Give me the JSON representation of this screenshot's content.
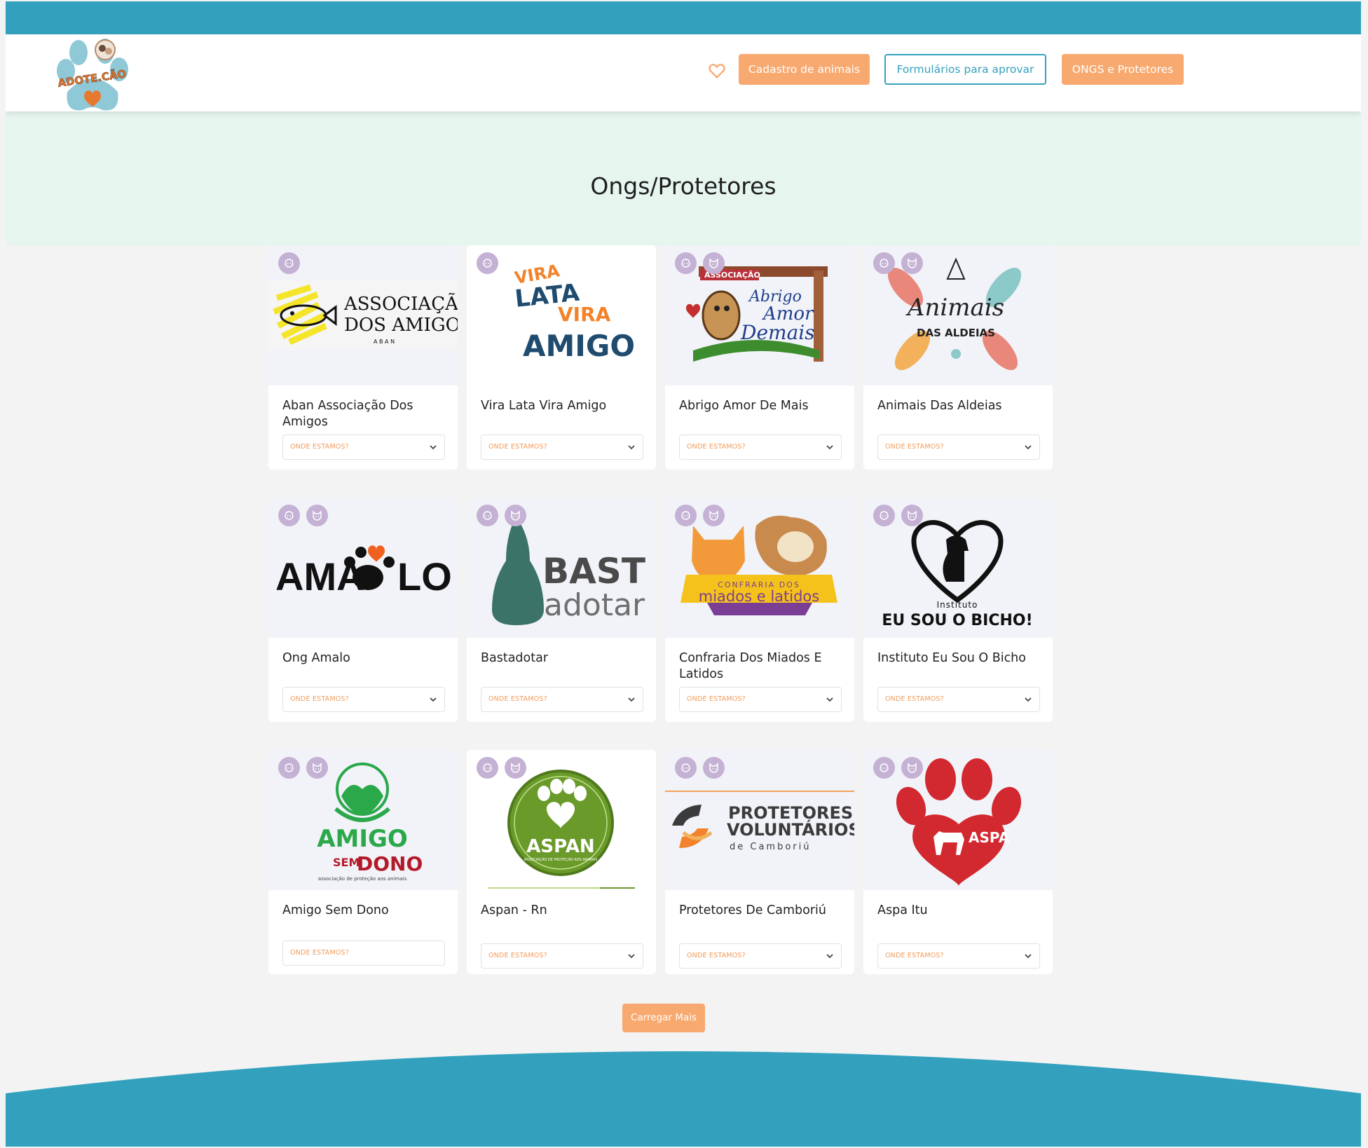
{
  "header": {
    "logo_text": "ADOTE.CÃO",
    "nav": {
      "favorites_icon": "heart-icon",
      "cadastro_label": "Cadastro de animais",
      "formularios_label": "Formulários para aprovar",
      "ongs_label": "ONGS e Protetores"
    }
  },
  "hero": {
    "title": "Ongs/Protetores"
  },
  "cards": [
    {
      "name": "Aban Associação Dos Amigos",
      "location_label": "ONDE ESTAMOS?",
      "logo": {
        "l1": "ASSOCIAÇÃO",
        "l2": "DOS AMIGOS",
        "l3": "A B A N"
      }
    },
    {
      "name": "Vira Lata Vira Amigo",
      "location_label": "ONDE ESTAMOS?",
      "logo": {
        "l1": "VIRA",
        "l2": "LATA",
        "l3": "VIRA",
        "l4": "AMIGO"
      }
    },
    {
      "name": "Abrigo Amor De Mais",
      "location_label": "ONDE ESTAMOS?",
      "logo": {
        "l1": "ASSOCIAÇÃO",
        "l2": "Abrigo",
        "l3": "Amor",
        "l4": "Demais"
      }
    },
    {
      "name": "Animais Das Aldeias",
      "location_label": "ONDE ESTAMOS?",
      "logo": {
        "l1": "Animais",
        "l2": "DAS ALDEIAS"
      }
    },
    {
      "name": "Ong Amalo",
      "location_label": "ONDE ESTAMOS?",
      "logo": {
        "l1": "AMA",
        "l2": "LO"
      }
    },
    {
      "name": "Bastadotar",
      "location_label": "ONDE ESTAMOS?",
      "logo": {
        "l1": "BAST",
        "l2": "adotar"
      }
    },
    {
      "name": "Confraria Dos Miados E Latidos",
      "location_label": "ONDE ESTAMOS?",
      "logo": {
        "l1": "CONFRARIA DOS",
        "l2": "miados e latidos"
      }
    },
    {
      "name": "Instituto Eu Sou O Bicho",
      "location_label": "ONDE ESTAMOS?",
      "logo": {
        "l1": "Instituto",
        "l2": "EU SOU O BICHO!"
      }
    },
    {
      "name": "Amigo Sem Dono",
      "location_label": "ONDE ESTAMOS?",
      "logo": {
        "l1": "AMIGO",
        "l2": "SEM",
        "l3": "DONO",
        "l4": "associação de proteção aos animais"
      }
    },
    {
      "name": "Aspan - Rn",
      "location_label": "ONDE ESTAMOS?",
      "logo": {
        "l1": "ASPAN",
        "l2": "ASSOCIAÇÃO DE PROTEÇÃO AOS ANIMAIS"
      }
    },
    {
      "name": "Protetores De Camboriú",
      "location_label": "ONDE ESTAMOS?",
      "logo": {
        "l1": "PROTETORES",
        "l2": "VOLUNTÁRIOS",
        "l3": "de Camboriú"
      }
    },
    {
      "name": "Aspa Itu",
      "location_label": "ONDE ESTAMOS?",
      "logo": {
        "l1": "ASPA"
      }
    }
  ],
  "load_more_label": "Carregar Mais",
  "colors": {
    "teal": "#33a1bd",
    "orange": "#f8a970",
    "mint": "#e7f5ef",
    "badge": "#c4b1d4"
  }
}
